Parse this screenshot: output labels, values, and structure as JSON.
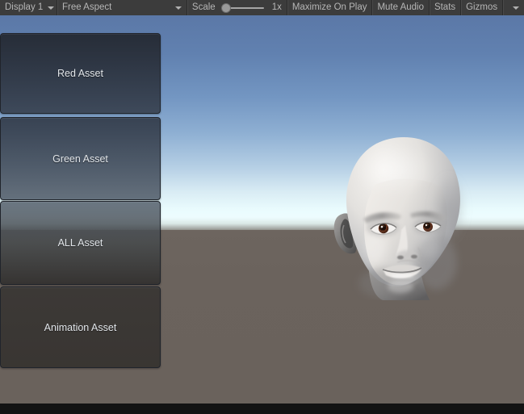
{
  "toolbar": {
    "display_label": "Display 1",
    "aspect_label": "Free Aspect",
    "scale_label": "Scale",
    "scale_value": "1x",
    "maximize_label": "Maximize On Play",
    "mute_label": "Mute Audio",
    "stats_label": "Stats",
    "gizmos_label": "Gizmos",
    "icons": {
      "display_caret": "chevron-down-icon",
      "aspect_caret": "chevron-down-icon",
      "gizmos_caret": "chevron-down-icon",
      "scale_slider_knob": "slider-handle"
    }
  },
  "game_view": {
    "buttons": [
      {
        "label": "Red Asset"
      },
      {
        "label": "Green Asset"
      },
      {
        "label": "ALL Asset"
      },
      {
        "label": "Animation Asset"
      }
    ],
    "scene": {
      "object": "human-head-model",
      "sky_top_color": "#5b78a7",
      "sky_horizon_color": "#eefdff",
      "ground_color": "#6b635d",
      "skin_color": "#e9e6e1",
      "eye_color": "#6b3420"
    }
  }
}
